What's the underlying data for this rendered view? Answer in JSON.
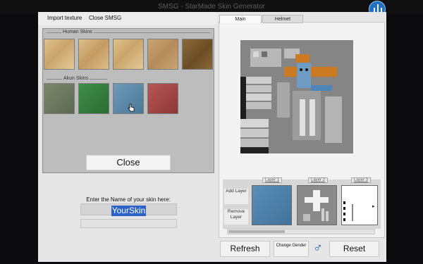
{
  "window": {
    "title": "SMSG - StarMade Skin Generator"
  },
  "menu": {
    "import_texture": "Import texture",
    "close_smsg": "Close SMSG"
  },
  "skins": {
    "human_label": "Human Skins",
    "akun_label": "Akun Skins"
  },
  "close_button": "Close",
  "name": {
    "label": "Enter the Name of your skin here:",
    "value": "YourSkin"
  },
  "tabs": {
    "main": "Main",
    "helmet": "Helmet"
  },
  "layers": {
    "add_label": "Add Layer",
    "remove_label": "Remove Layer",
    "tabs": [
      "Layer 1",
      "Layer 2",
      "Layer 3"
    ]
  },
  "buttons": {
    "refresh": "Refresh",
    "change_gender": "Change Gender",
    "gender_symbol": "♂",
    "reset": "Reset"
  },
  "colors": {
    "selection": "#2a62c9",
    "accent": "#1e4fa8"
  }
}
